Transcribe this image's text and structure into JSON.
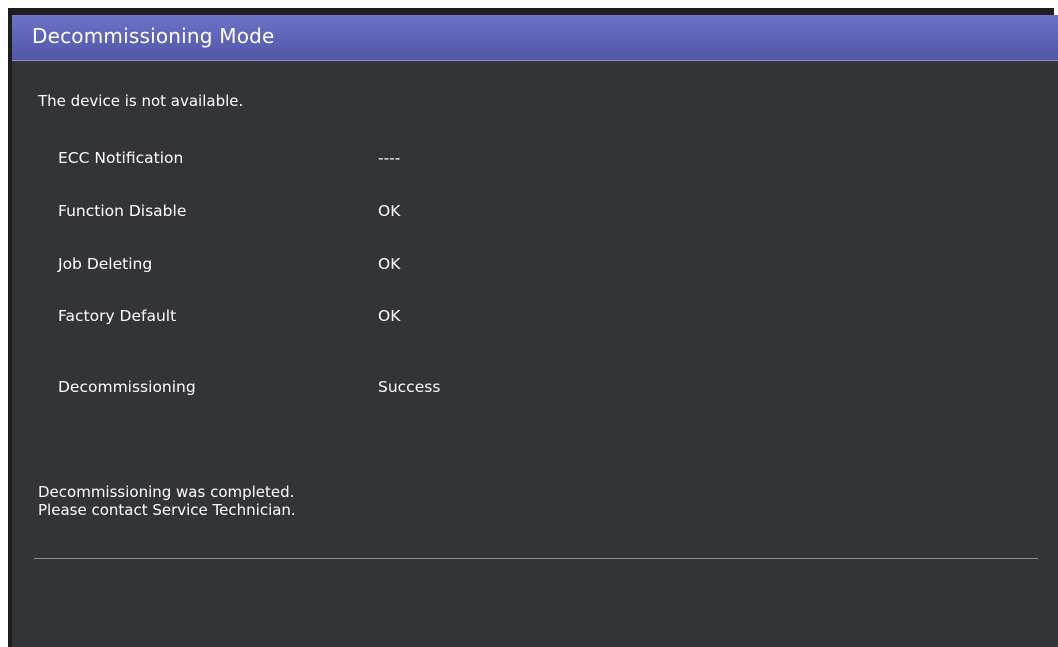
{
  "window": {
    "title": "Decommissioning Mode"
  },
  "main": {
    "status_text": "The device is not available.",
    "items": [
      {
        "label": "ECC Notification",
        "value": "----"
      },
      {
        "label": "Function Disable",
        "value": "OK"
      },
      {
        "label": "Job Deleting",
        "value": "OK"
      },
      {
        "label": "Factory Default",
        "value": "OK"
      },
      {
        "label": "Decommissioning",
        "value": "Success"
      }
    ],
    "message_line1": "Decommissioning was completed.",
    "message_line2": "Please contact Service Technician."
  },
  "colors": {
    "titlebar": "#5f63b6",
    "background": "#333438",
    "text": "#ffffff"
  }
}
